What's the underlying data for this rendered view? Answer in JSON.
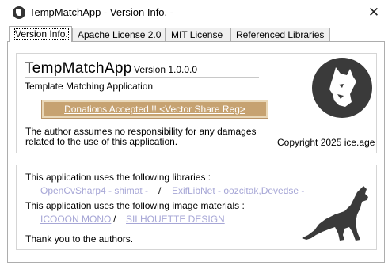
{
  "window": {
    "title": "TempMatchApp  - Version Info. -",
    "close_glyph": "✕"
  },
  "tabs": [
    {
      "label": "Version Info.",
      "active": true
    },
    {
      "label": "Apache License 2.0",
      "active": false
    },
    {
      "label": "MIT License",
      "active": false
    },
    {
      "label": "Referenced Libraries",
      "active": false
    }
  ],
  "app": {
    "name": "TempMatchApp",
    "version": "Version 1.0.0.0",
    "description": "Template Matching Application",
    "donate_label": "Donations Accepted !!  <Vector Share Reg>",
    "disclaimer": "The author assumes no responsibility for any damages related to the use of this application.",
    "copyright": "Copyright 2025 ice.age"
  },
  "credits": {
    "libraries_intro": "This application uses the following libraries :",
    "libraries": [
      "OpenCvSharp4  - shimat -",
      "ExifLibNet  - oozcitak,Devedse -"
    ],
    "materials_intro": "This application uses the following image materials :",
    "materials": [
      "ICOOON MONO",
      "SILHOUETTE DESIGN"
    ],
    "separator": "/",
    "thanks": "Thank you to the authors."
  },
  "colors": {
    "donate_bg": "#c6a271",
    "link": "#a6a6d6",
    "logo": "#3a3a3a"
  },
  "icons": {
    "app": "app-logo-icon",
    "logo": "dog-face-logo",
    "wolf": "howling-wolf-silhouette"
  }
}
